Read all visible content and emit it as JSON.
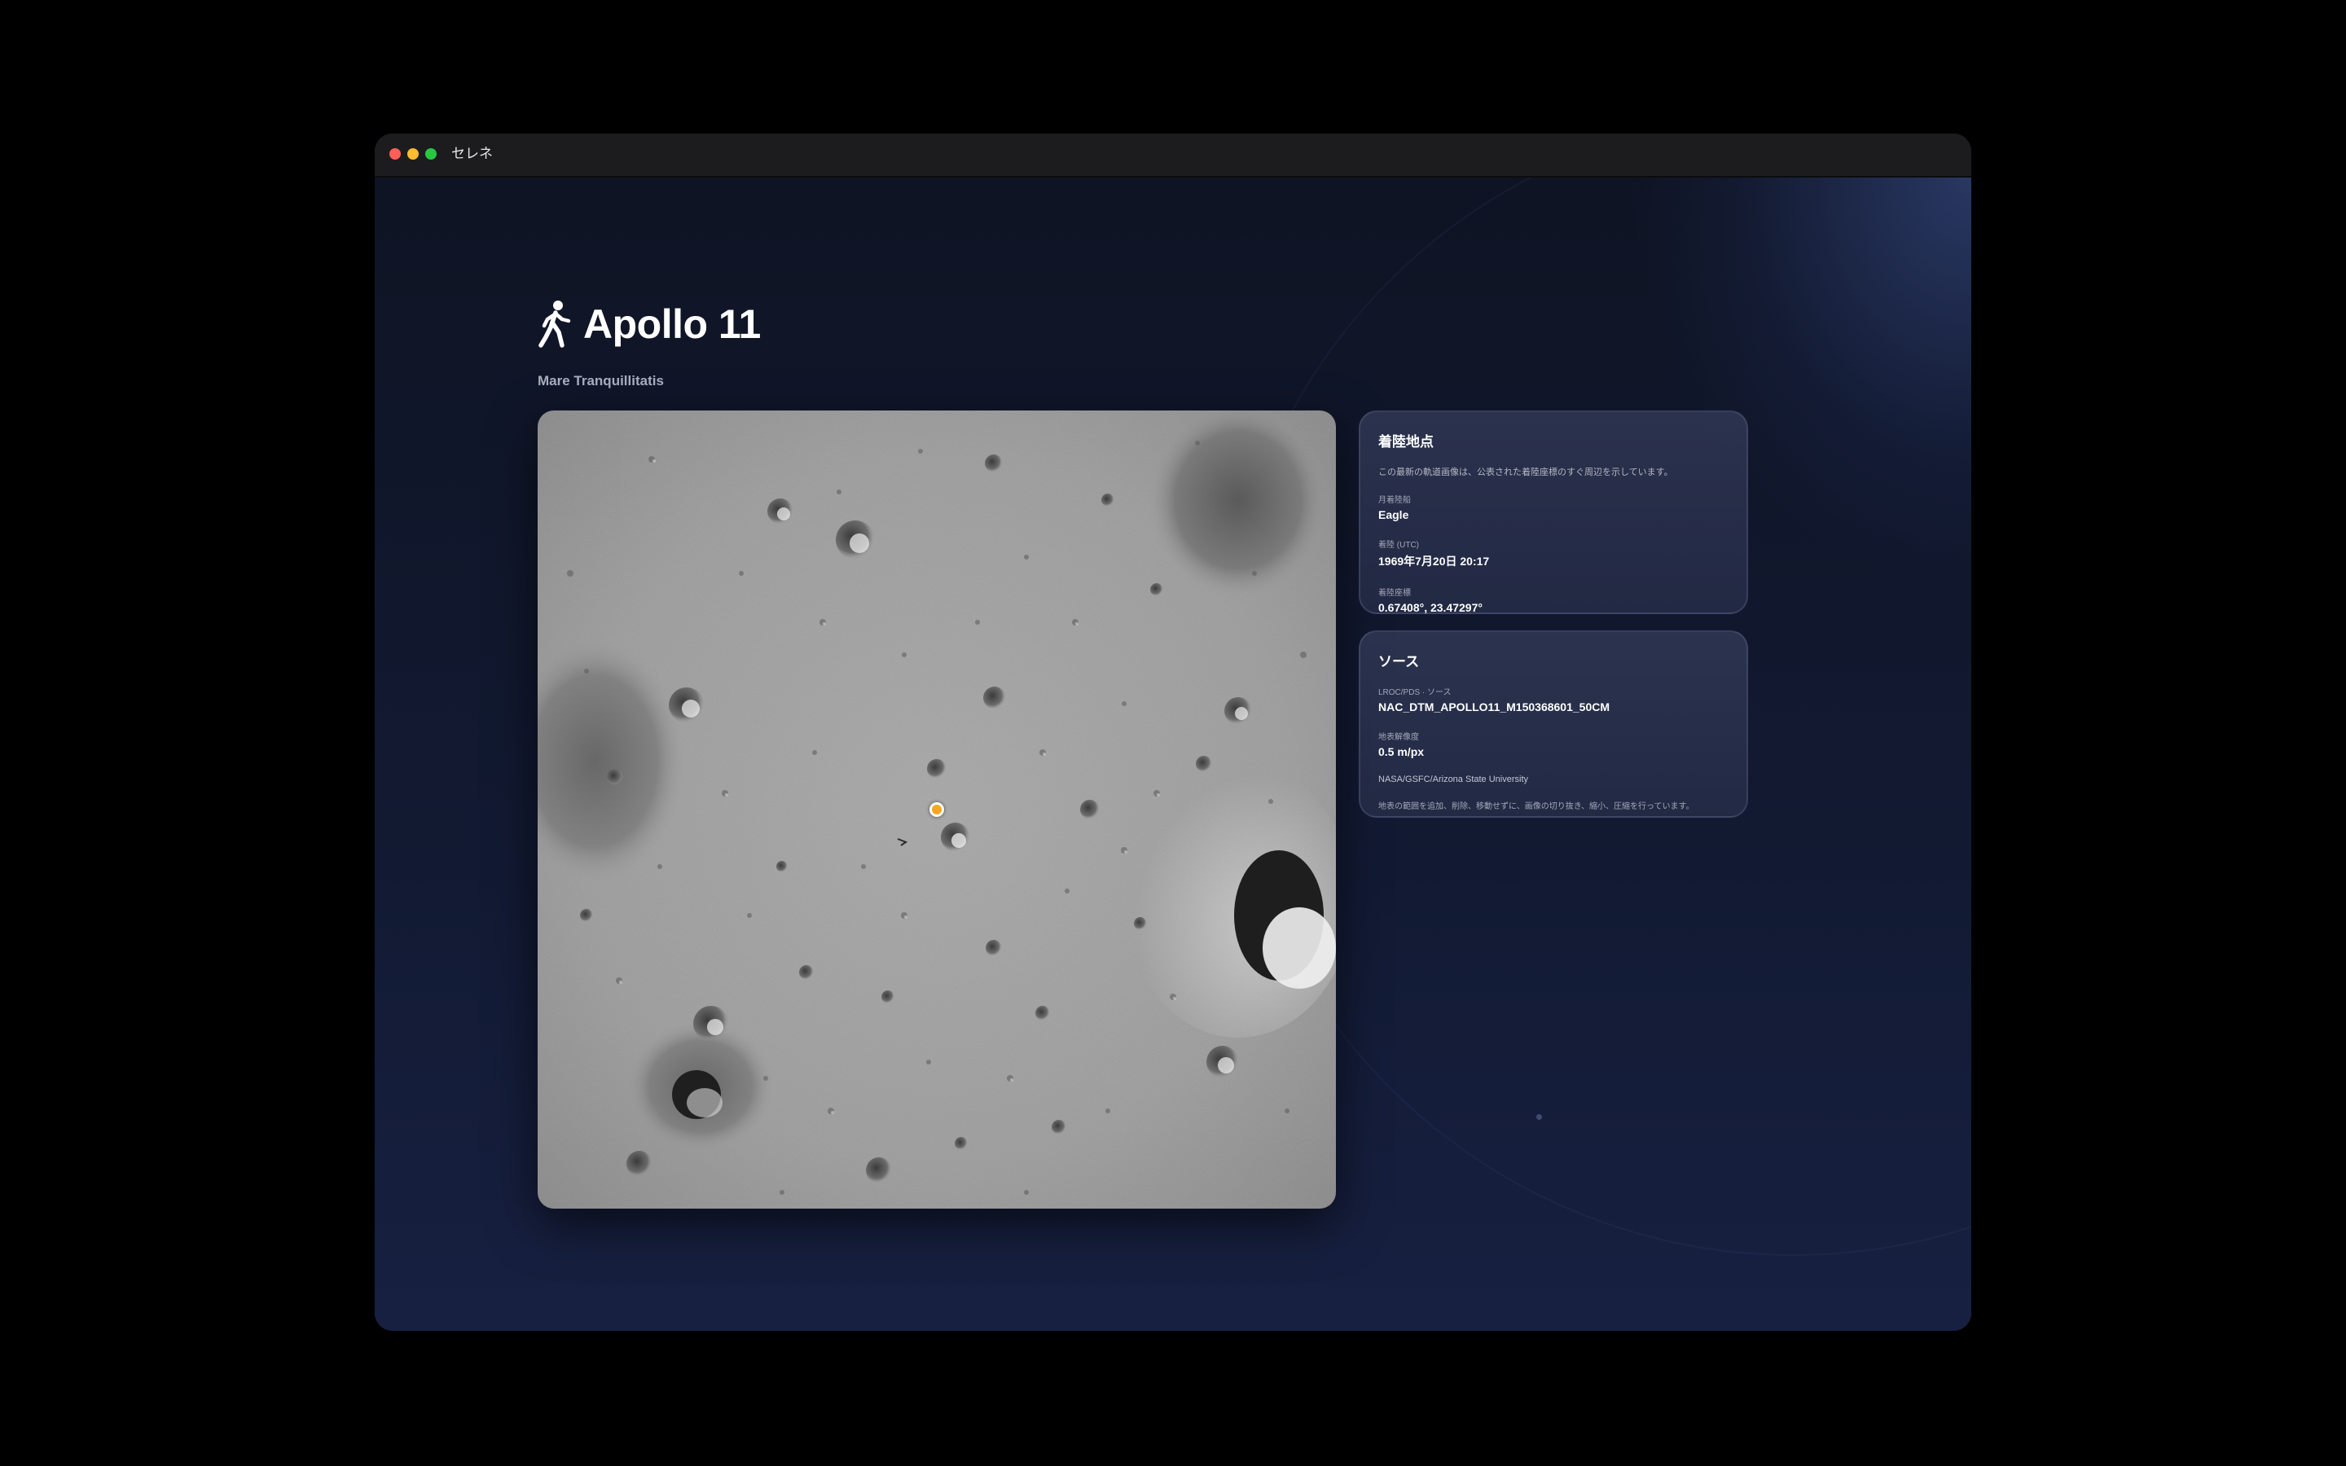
{
  "window": {
    "title": "セレネ"
  },
  "header": {
    "icon": "person-walking-icon",
    "title": "Apollo 11",
    "subtitle": "Mare Tranquillitatis"
  },
  "landing_card": {
    "title": "着陸地点",
    "description": "この最新の軌道画像は、公表された着陸座標のすぐ周辺を示しています。",
    "lander_label": "月着陸船",
    "lander_value": "Eagle",
    "time_label": "着陸 (UTC)",
    "time_value": "1969年7月20日 20:17",
    "coords_label": "着陸座標",
    "coords_value": "0.67408°, 23.47297°"
  },
  "source_card": {
    "title": "ソース",
    "source_label": "LROC/PDS · ソース",
    "source_value": "NAC_DTM_APOLLO11_M150368601_50CM",
    "resolution_label": "地表解像度",
    "resolution_value": "0.5 m/px",
    "credit": "NASA/GSFC/Arizona State University",
    "note": "地表の範囲を追加、削除、移動せずに、画像の切り抜き、縮小、圧縮を行っています。"
  },
  "colors": {
    "accent_marker": "#f5a623",
    "background": "#111629"
  }
}
